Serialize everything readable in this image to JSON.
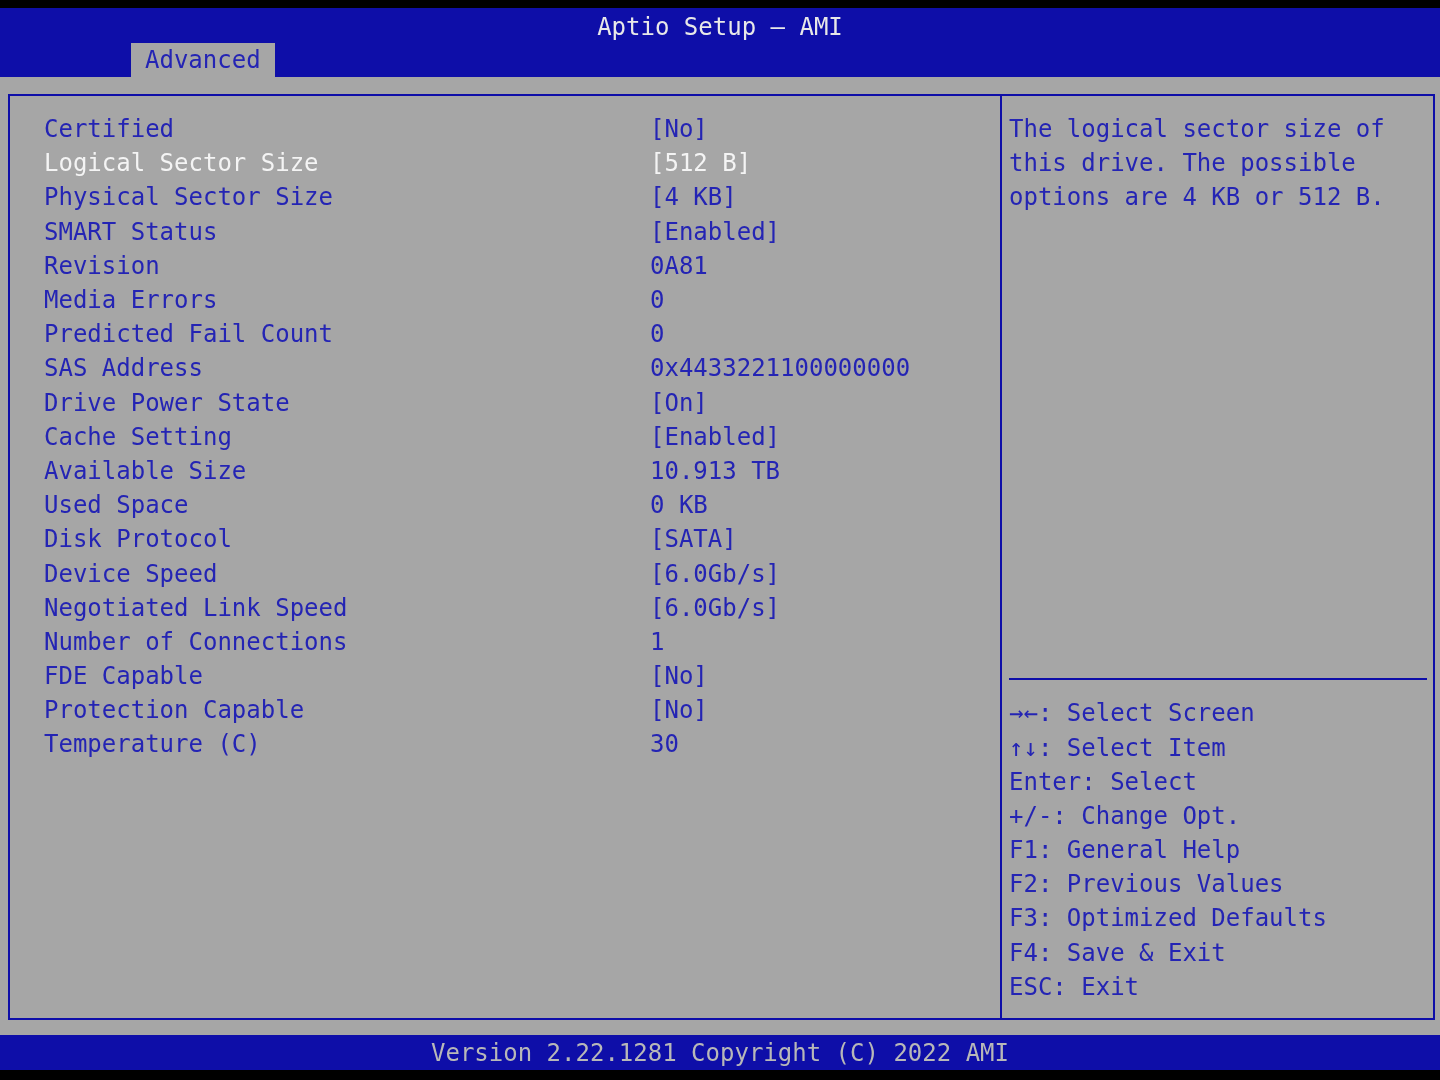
{
  "window": {
    "title": "Aptio Setup – AMI"
  },
  "tabs": [
    {
      "label": "Advanced",
      "selected": true
    }
  ],
  "items": [
    {
      "label": "Certified",
      "value": "[No]",
      "selected": false
    },
    {
      "label": "Logical Sector Size",
      "value": "[512 B]",
      "selected": true
    },
    {
      "label": "Physical Sector Size",
      "value": "[4 KB]",
      "selected": false
    },
    {
      "label": "SMART Status",
      "value": "[Enabled]",
      "selected": false
    },
    {
      "label": "Revision",
      "value": "0A81",
      "selected": false
    },
    {
      "label": "Media Errors",
      "value": "0",
      "selected": false
    },
    {
      "label": "Predicted Fail Count",
      "value": "0",
      "selected": false
    },
    {
      "label": "SAS Address",
      "value": "0x4433221100000000",
      "selected": false
    },
    {
      "label": "Drive Power State",
      "value": "[On]",
      "selected": false
    },
    {
      "label": "Cache Setting",
      "value": "[Enabled]",
      "selected": false
    },
    {
      "label": "Available Size",
      "value": "10.913 TB",
      "selected": false
    },
    {
      "label": "Used Space",
      "value": "0 KB",
      "selected": false
    },
    {
      "label": "Disk Protocol",
      "value": "[SATA]",
      "selected": false
    },
    {
      "label": "Device Speed",
      "value": "[6.0Gb/s]",
      "selected": false
    },
    {
      "label": "Negotiated Link Speed",
      "value": "[6.0Gb/s]",
      "selected": false
    },
    {
      "label": "Number of Connections",
      "value": "1",
      "selected": false
    },
    {
      "label": "FDE Capable",
      "value": "[No]",
      "selected": false
    },
    {
      "label": "Protection Capable",
      "value": "[No]",
      "selected": false
    },
    {
      "label": "Temperature (C)",
      "value": "30",
      "selected": false
    }
  ],
  "help_text": "The logical sector size of this drive. The possible options are 4 KB or 512 B.",
  "key_help": [
    "→←: Select Screen",
    "↑↓: Select Item",
    "Enter: Select",
    "+/-: Change Opt.",
    "F1: General Help",
    "F2: Previous Values",
    "F3: Optimized Defaults",
    "F4: Save & Exit",
    "ESC: Exit"
  ],
  "status_bar": "Version 2.22.1281 Copyright (C) 2022 AMI"
}
